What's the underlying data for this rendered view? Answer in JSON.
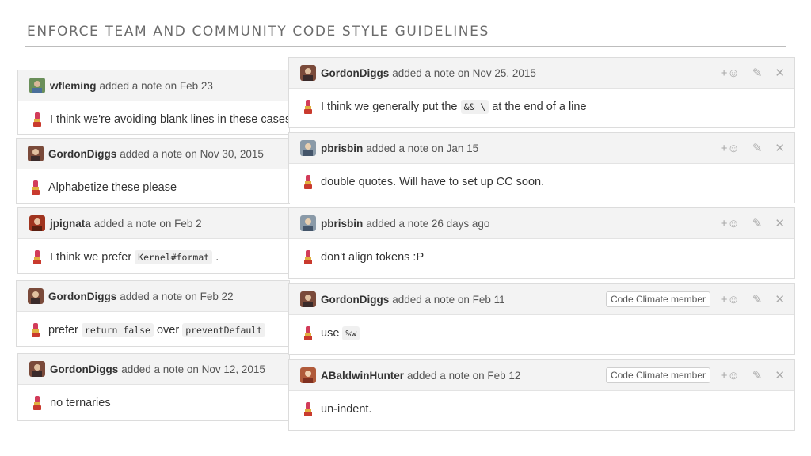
{
  "slide_title": "ENFORCE TEAM AND COMMUNITY CODE STYLE GUIDELINES",
  "left_notes": [
    {
      "author": "wfleming",
      "meta": "added a note on Feb 23",
      "pre": "I think we're avoiding blank lines in these cases in",
      "code": "",
      "post": ""
    },
    {
      "author": "GordonDiggs",
      "meta": "added a note on Nov 30, 2015",
      "pre": "Alphabetize these please",
      "code": "",
      "post": ""
    },
    {
      "author": "jpignata",
      "meta": "added a note on Feb 2",
      "pre": "I think we prefer",
      "code": "Kernel#format",
      "post": "."
    },
    {
      "author": "GordonDiggs",
      "meta": "added a note on Feb 22",
      "pre": "prefer",
      "code": "return false",
      "post": "over",
      "code2": "preventDefault"
    },
    {
      "author": "GordonDiggs",
      "meta": "added a note on Nov 12, 2015",
      "pre": "no ternaries",
      "code": "",
      "post": ""
    }
  ],
  "right_notes": [
    {
      "author": "GordonDiggs",
      "meta": "added a note on Nov 25, 2015",
      "pre": "I think we generally put the",
      "code": "&& \\",
      "post": "at the end of a line",
      "badge": ""
    },
    {
      "author": "pbrisbin",
      "meta": "added a note on Jan 15",
      "pre": "double quotes. Will have to set up CC soon.",
      "code": "",
      "post": "",
      "badge": ""
    },
    {
      "author": "pbrisbin",
      "meta": "added a note 26 days ago",
      "pre": "don't align tokens :P",
      "code": "",
      "post": "",
      "badge": ""
    },
    {
      "author": "GordonDiggs",
      "meta": "added a note on Feb 11",
      "pre": "use",
      "code": "%w",
      "post": "",
      "badge": "Code Climate member"
    },
    {
      "author": "ABaldwinHunter",
      "meta": "added a note on Feb 12",
      "pre": "un-indent.",
      "code": "",
      "post": "",
      "badge": "Code Climate member"
    }
  ],
  "actions": {
    "react": "+☺",
    "edit": "✎",
    "close": "✕"
  },
  "icons": {
    "emoji": "lipstick-icon",
    "avatar": "user-avatar-icon"
  },
  "colors": {
    "header_bg": "#f3f3f3",
    "border": "#dcdcdc",
    "title": "#6b6b6b"
  }
}
